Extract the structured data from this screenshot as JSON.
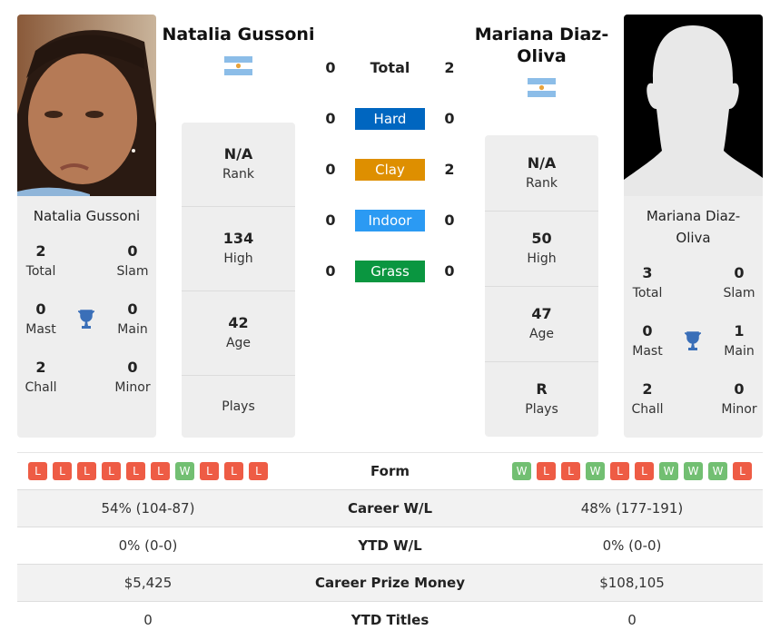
{
  "player1": {
    "name": "Natalia Gussoni",
    "country_flag": "argentina-flag",
    "card_name": "Natalia Gussoni",
    "titles": {
      "total": {
        "value": "2",
        "label": "Total"
      },
      "slam": {
        "value": "0",
        "label": "Slam"
      },
      "mast": {
        "value": "0",
        "label": "Mast"
      },
      "main": {
        "value": "0",
        "label": "Main"
      },
      "chall": {
        "value": "2",
        "label": "Chall"
      },
      "minor": {
        "value": "0",
        "label": "Minor"
      }
    },
    "info": [
      {
        "value": "N/A",
        "label": "Rank"
      },
      {
        "value": "134",
        "label": "High"
      },
      {
        "value": "42",
        "label": "Age"
      },
      {
        "value": "",
        "label": "Plays"
      }
    ],
    "form": [
      "L",
      "L",
      "L",
      "L",
      "L",
      "L",
      "W",
      "L",
      "L",
      "L"
    ],
    "career_wl": "54% (104-87)",
    "ytd_wl": "0% (0-0)",
    "prize_money": "$5,425",
    "ytd_titles": "0"
  },
  "player2": {
    "name": "Mariana Diaz-Oliva",
    "name_line1": "Mariana Diaz-",
    "name_line2": "Oliva",
    "country_flag": "argentina-flag",
    "card_name_line1": "Mariana Diaz-",
    "card_name_line2": "Oliva",
    "titles": {
      "total": {
        "value": "3",
        "label": "Total"
      },
      "slam": {
        "value": "0",
        "label": "Slam"
      },
      "mast": {
        "value": "0",
        "label": "Mast"
      },
      "main": {
        "value": "1",
        "label": "Main"
      },
      "chall": {
        "value": "2",
        "label": "Chall"
      },
      "minor": {
        "value": "0",
        "label": "Minor"
      }
    },
    "info": [
      {
        "value": "N/A",
        "label": "Rank"
      },
      {
        "value": "50",
        "label": "High"
      },
      {
        "value": "47",
        "label": "Age"
      },
      {
        "value": "R",
        "label": "Plays"
      }
    ],
    "form": [
      "W",
      "L",
      "L",
      "W",
      "L",
      "L",
      "W",
      "W",
      "W",
      "L"
    ],
    "career_wl": "48% (177-191)",
    "ytd_wl": "0% (0-0)",
    "prize_money": "$108,105",
    "ytd_titles": "0"
  },
  "h2h": {
    "rows": [
      {
        "label": "Total",
        "p1": "0",
        "p2": "2",
        "color": null
      },
      {
        "label": "Hard",
        "p1": "0",
        "p2": "0",
        "color": "#0066c0"
      },
      {
        "label": "Clay",
        "p1": "0",
        "p2": "2",
        "color": "#de8f00"
      },
      {
        "label": "Indoor",
        "p1": "0",
        "p2": "0",
        "color": "#2b9af3"
      },
      {
        "label": "Grass",
        "p1": "0",
        "p2": "0",
        "color": "#0a9640"
      }
    ]
  },
  "comparison": {
    "form_label": "Form",
    "career_wl_label": "Career W/L",
    "ytd_wl_label": "YTD W/L",
    "prize_label": "Career Prize Money",
    "ytd_titles_label": "YTD Titles"
  },
  "colors": {
    "loss": "#ee5c45",
    "win": "#72bf72",
    "trophy": "#3a6fb8"
  }
}
